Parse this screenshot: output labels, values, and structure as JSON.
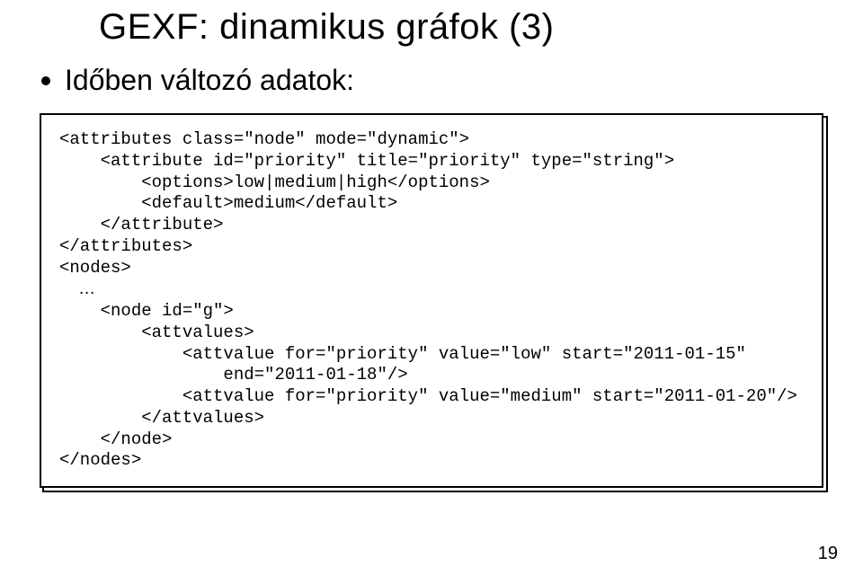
{
  "title": "GEXF: dinamikus gráfok (3)",
  "bullet": "Időben változó adatok:",
  "code": {
    "l01": "<attributes class=\"node\" mode=\"dynamic\">",
    "l02": "    <attribute id=\"priority\" title=\"priority\" type=\"string\">",
    "l03": "        <options>low|medium|high</options>",
    "l04": "        <default>medium</default>",
    "l05": "    </attribute>",
    "l06": "</attributes>",
    "l07": "<nodes>",
    "l08": "    …",
    "l09": "    <node id=\"g\">",
    "l10": "        <attvalues>",
    "l11": "            <attvalue for=\"priority\" value=\"low\" start=\"2011-01-15\"",
    "l12": "                end=\"2011-01-18\"/>",
    "l13": "            <attvalue for=\"priority\" value=\"medium\" start=\"2011-01-20\"/>",
    "l14": "        </attvalues>",
    "l15": "    </node>",
    "l16": "</nodes>"
  },
  "page": "19"
}
